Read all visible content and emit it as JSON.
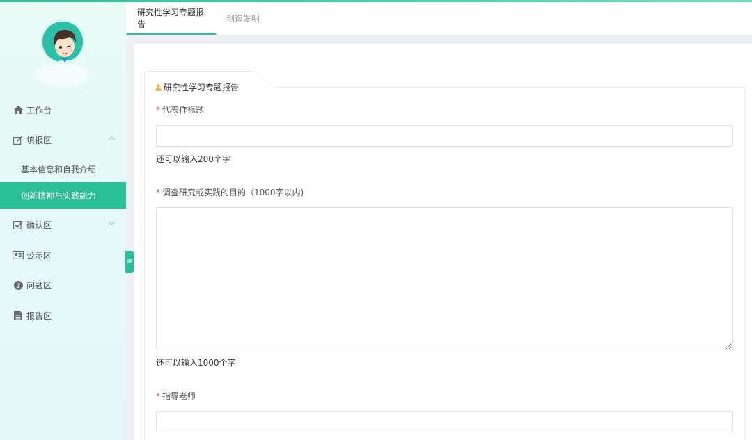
{
  "sidebar": {
    "items": [
      {
        "label": "工作台",
        "icon": "home-icon"
      },
      {
        "label": "填报区",
        "icon": "edit-icon"
      },
      {
        "label": "确认区",
        "icon": "checkbox-icon"
      },
      {
        "label": "公示区",
        "icon": "newspaper-icon"
      },
      {
        "label": "问题区",
        "icon": "question-circle-icon"
      },
      {
        "label": "报告区",
        "icon": "file-icon"
      }
    ],
    "subitems": [
      {
        "label": "基本信息和自我介绍",
        "active": false
      },
      {
        "label": "创新精神与实践能力",
        "active": true
      }
    ],
    "accent_color": "#2bbf98"
  },
  "tabs": [
    {
      "label": "研究性学习专题报告",
      "active": true
    },
    {
      "label": "创造发明",
      "active": false
    }
  ],
  "panel": {
    "title": "研究性学习专题报告",
    "fields": [
      {
        "label": "代表作标题",
        "value": "",
        "hint": "还可以输入200个字"
      },
      {
        "label": "调查研究或实践的目的（1000字以内)",
        "value": "",
        "hint": "还可以输入1000个字"
      },
      {
        "label": "指导老师",
        "value": ""
      }
    ]
  }
}
